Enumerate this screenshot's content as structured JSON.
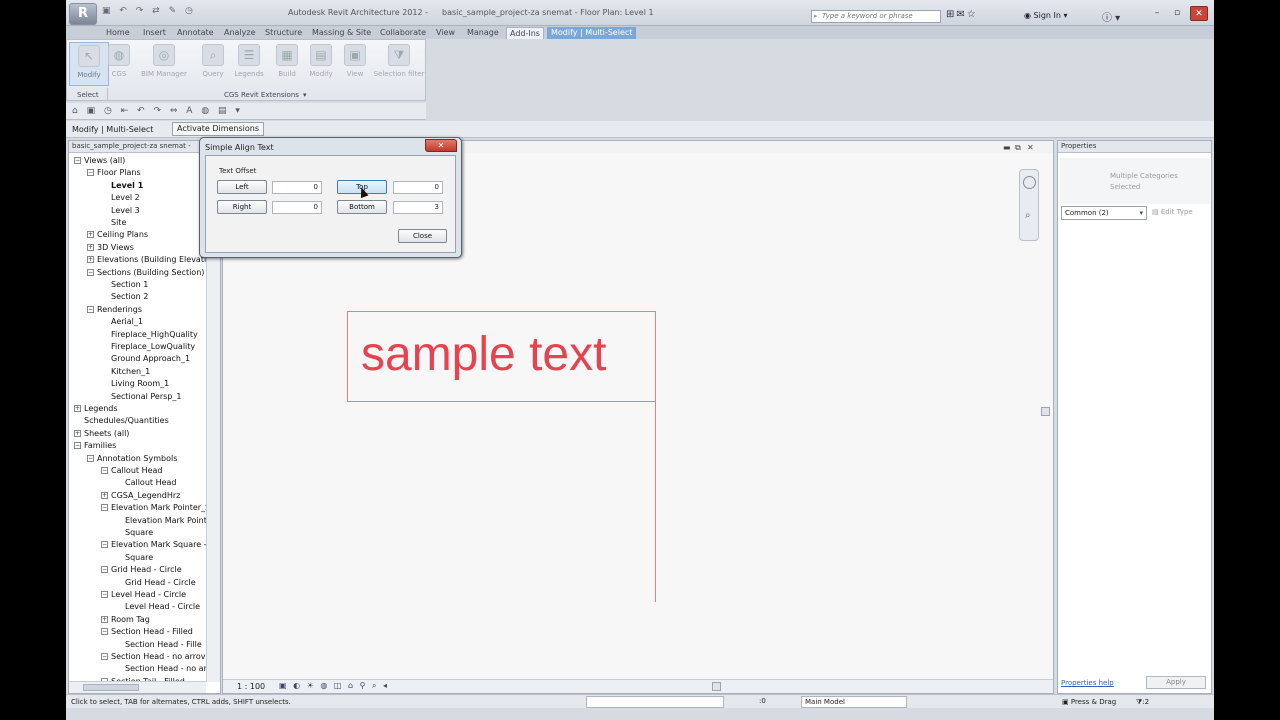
{
  "title_bar": {
    "app_title": "Autodesk Revit Architecture 2012 -",
    "doc_title": "basic_sample_project-za snemat - Floor Plan: Level 1",
    "search_placeholder": "Type a keyword or phrase",
    "sign_in": "Sign In"
  },
  "tabs": [
    "Home",
    "Insert",
    "Annotate",
    "Analyze",
    "Structure",
    "Massing & Site",
    "Collaborate",
    "View",
    "Manage",
    "Add-Ins",
    "Modify | Multi-Select"
  ],
  "ribbon": {
    "buttons": [
      {
        "label": "Modify",
        "icon": "modify-icon"
      },
      {
        "label": "CGS",
        "icon": "cgs-icon"
      },
      {
        "label": "BIM Manager",
        "icon": "bim-manager-icon"
      },
      {
        "label": "Query",
        "icon": "query-icon"
      },
      {
        "label": "Legends",
        "icon": "legends-icon"
      },
      {
        "label": "Build",
        "icon": "build-icon"
      },
      {
        "label": "Modify",
        "icon": "modify-tools-icon"
      },
      {
        "label": "View",
        "icon": "view-icon"
      },
      {
        "label": "Selection filter",
        "icon": "filter-icon"
      }
    ],
    "panel_select": "Select",
    "panel_cgs": "CGS Revit Extensions"
  },
  "options_bar": {
    "label": "Modify | Multi-Select",
    "button": "Activate Dimensions"
  },
  "browser": {
    "title": "basic_sample_project-za snemat -",
    "nodes": [
      {
        "text": "Views (all)",
        "box": "−",
        "level": 0
      },
      {
        "text": "Floor Plans",
        "box": "−",
        "level": 1
      },
      {
        "text": "Level 1",
        "box": "",
        "level": 2,
        "bold": true
      },
      {
        "text": "Level 2",
        "box": "",
        "level": 2
      },
      {
        "text": "Level 3",
        "box": "",
        "level": 2
      },
      {
        "text": "Site",
        "box": "",
        "level": 2
      },
      {
        "text": "Ceiling Plans",
        "box": "+",
        "level": 1
      },
      {
        "text": "3D Views",
        "box": "+",
        "level": 1
      },
      {
        "text": "Elevations (Building Elevatio",
        "box": "+",
        "level": 1
      },
      {
        "text": "Sections (Building Section)",
        "box": "−",
        "level": 1
      },
      {
        "text": "Section 1",
        "box": "",
        "level": 2
      },
      {
        "text": "Section 2",
        "box": "",
        "level": 2
      },
      {
        "text": "Renderings",
        "box": "−",
        "level": 1
      },
      {
        "text": "Aerial_1",
        "box": "",
        "level": 2
      },
      {
        "text": "Fireplace_HighQuality",
        "box": "",
        "level": 2
      },
      {
        "text": "Fireplace_LowQuality",
        "box": "",
        "level": 2
      },
      {
        "text": "Ground Approach_1",
        "box": "",
        "level": 2
      },
      {
        "text": "Kitchen_1",
        "box": "",
        "level": 2
      },
      {
        "text": "Living Room_1",
        "box": "",
        "level": 2
      },
      {
        "text": "Sectional Persp_1",
        "box": "",
        "level": 2
      },
      {
        "text": "Legends",
        "box": "+",
        "level": 0
      },
      {
        "text": "Schedules/Quantities",
        "box": "",
        "level": 0
      },
      {
        "text": "Sheets (all)",
        "box": "+",
        "level": 0
      },
      {
        "text": "Families",
        "box": "−",
        "level": 0
      },
      {
        "text": "Annotation Symbols",
        "box": "−",
        "level": 1
      },
      {
        "text": "Callout Head",
        "box": "−",
        "level": 2
      },
      {
        "text": "Callout Head",
        "box": "",
        "level": 3
      },
      {
        "text": "CGSA_LegendHrz",
        "box": "+",
        "level": 2
      },
      {
        "text": "Elevation Mark Pointer_S",
        "box": "−",
        "level": 2
      },
      {
        "text": "Elevation Mark Point",
        "box": "",
        "level": 3
      },
      {
        "text": "Square",
        "box": "",
        "level": 3
      },
      {
        "text": "Elevation Mark Square -",
        "box": "−",
        "level": 2
      },
      {
        "text": "Square",
        "box": "",
        "level": 3
      },
      {
        "text": "Grid Head - Circle",
        "box": "−",
        "level": 2
      },
      {
        "text": "Grid Head - Circle",
        "box": "",
        "level": 3
      },
      {
        "text": "Level Head - Circle",
        "box": "−",
        "level": 2
      },
      {
        "text": "Level Head - Circle",
        "box": "",
        "level": 3
      },
      {
        "text": "Room Tag",
        "box": "+",
        "level": 2
      },
      {
        "text": "Section Head - Filled",
        "box": "−",
        "level": 2
      },
      {
        "text": "Section Head - Fille",
        "box": "",
        "level": 3
      },
      {
        "text": "Section Head - no arrov",
        "box": "−",
        "level": 2
      },
      {
        "text": "Section Head - no ar",
        "box": "",
        "level": 3
      },
      {
        "text": "Section Tail - Filled",
        "box": "−",
        "level": 2
      }
    ]
  },
  "drawing": {
    "sample_text": "sample text",
    "scale": "1 : 100"
  },
  "properties": {
    "title": "Properties",
    "type_label": "Multiple Categories Selected",
    "filter": "Common (2)",
    "edit_type": "Edit Type",
    "help": "Properties help",
    "apply": "Apply"
  },
  "status_bar": {
    "message": "Click to select, TAB for alternates, CTRL adds, SHIFT unselects.",
    "zero": ":0",
    "model": "Main Model",
    "press_drag": "Press & Drag",
    "filter_count": ":2"
  },
  "dialog": {
    "title": "Simple Align Text",
    "group_label": "Text Offset",
    "left_label": "Left",
    "left_value": "0",
    "top_label": "Top",
    "top_value": "0",
    "right_label": "Right",
    "right_value": "0",
    "bottom_label": "Bottom",
    "bottom_value": "3",
    "close_label": "Close"
  }
}
